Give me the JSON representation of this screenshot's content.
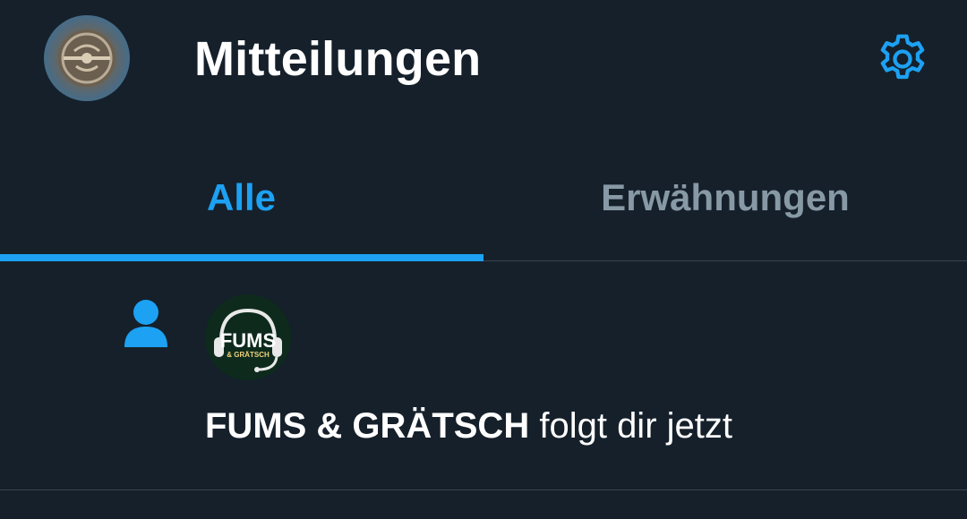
{
  "header": {
    "title": "Mitteilungen",
    "avatar_icon": "profile-avatar",
    "settings_icon": "gear-icon"
  },
  "tabs": [
    {
      "label": "Alle",
      "active": true
    },
    {
      "label": "Erwähnungen",
      "active": false
    }
  ],
  "notifications": [
    {
      "type_icon": "person-icon",
      "user_name": "FUMS & GRÄTSCH",
      "action_text": "folgt dir jetzt",
      "avatar_text_main": "FUMS",
      "avatar_text_sub": "& GRÄTSCH"
    }
  ],
  "colors": {
    "background": "#15202b",
    "accent": "#1da1f2",
    "muted": "#8899a6",
    "divider": "#38444d",
    "text": "#ffffff"
  }
}
